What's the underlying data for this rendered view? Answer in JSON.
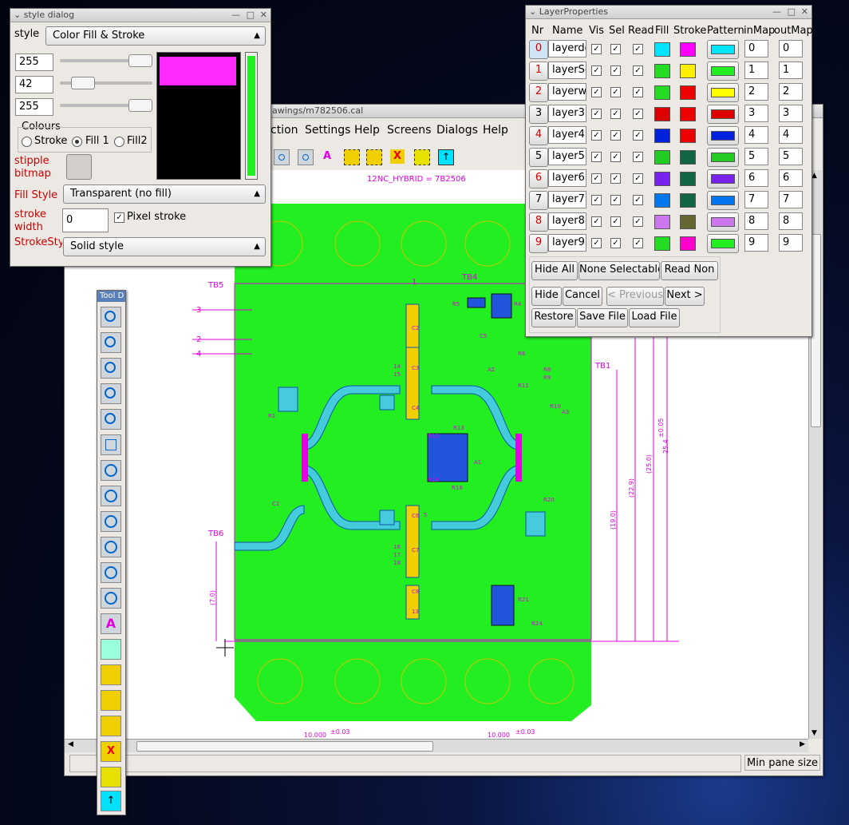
{
  "main_window": {
    "title": "awings/m782506.cal",
    "menu": [
      "ction",
      "Settings",
      "Help",
      "Screens",
      "Dialogs",
      "Help"
    ],
    "status": "Min pane size ="
  },
  "canvas": {
    "top_label": "12NC_HYBRID = 7B2506",
    "labels": [
      "TB5",
      "TB4",
      "TB1",
      "TB6",
      "3",
      "2",
      "4",
      "1"
    ],
    "dims": [
      "(7.0)",
      "(19.0)",
      "(22.9)",
      "(25.0)",
      "25.4",
      "±0.05",
      "10.000",
      "±0.03",
      "10.000",
      "±0.03"
    ],
    "parts": [
      "R1",
      "R5",
      "R4",
      "R6",
      "R8",
      "R9",
      "R10",
      "R11",
      "R12",
      "R13",
      "R18",
      "R19",
      "R20",
      "R21",
      "R24",
      "A1",
      "A2",
      "A3",
      "C1",
      "C2",
      "C3",
      "C4",
      "C5",
      "C6",
      "C7",
      "C8",
      "13",
      "14",
      "15",
      "16",
      "17",
      "18",
      "5"
    ]
  },
  "style_dialog": {
    "title": "style dialog",
    "style_label": "style",
    "style_value": "Color Fill & Stroke",
    "rgb": [
      "255",
      "42",
      "255"
    ],
    "colours_label": "Colours",
    "radios": [
      "Stroke",
      "Fill 1",
      "Fill2"
    ],
    "selected_radio": "Fill 1",
    "stipple_label": "stipple bitmap",
    "fill_style_label": "Fill Style",
    "fill_style_value": "Transparent (no fill)",
    "stroke_width_label": "stroke width",
    "stroke_width_value": "0",
    "pixel_stroke_label": "Pixel stroke",
    "stroke_style_label": "StrokeStyl",
    "stroke_style_value": "Solid style",
    "preview_color": "#ff2aff"
  },
  "tool_dock": {
    "title": "Tool D",
    "tools": [
      "zoom-icon",
      "zoom-region-icon",
      "zoom-fit-icon",
      "zoom-prev-icon",
      "zoom-in-icon",
      "zoom-out-icon",
      "snap-1-icon",
      "snap-2-icon",
      "snap-3-icon",
      "snap-4-icon",
      "snap-5-icon",
      "snap-6-icon",
      "text-icon",
      "image-icon",
      "rotate-icon",
      "select-icon",
      "select-add-icon",
      "delete-icon",
      "move-icon",
      "export-icon"
    ]
  },
  "layer_props": {
    "title": "LayerProperties",
    "headers": [
      "Nr",
      "Name",
      "Vis",
      "Sel",
      "Read",
      "Fill",
      "Stroke",
      "Pattern",
      "inMap",
      "outMap"
    ],
    "rows": [
      {
        "nr": "0",
        "name": "layerdef",
        "fill": "#00e5ff",
        "stroke": "#ff00ff",
        "pattern": "#00e5ff",
        "inmap": "0",
        "outmap": "0",
        "red": true
      },
      {
        "nr": "1",
        "name": "layerSe",
        "fill": "#22dd22",
        "stroke": "#ffee00",
        "pattern": "#22ee22",
        "inmap": "1",
        "outmap": "1",
        "red": true
      },
      {
        "nr": "2",
        "name": "layerwi",
        "fill": "#22dd22",
        "stroke": "#ee0000",
        "pattern": "#ffff00",
        "inmap": "2",
        "outmap": "2",
        "red": true
      },
      {
        "nr": "3",
        "name": "layer3",
        "fill": "#dd0000",
        "stroke": "#ee0000",
        "pattern": "#dd0000",
        "inmap": "3",
        "outmap": "3",
        "red": false
      },
      {
        "nr": "4",
        "name": "layer4",
        "fill": "#0022dd",
        "stroke": "#ee0000",
        "pattern": "#0022dd",
        "inmap": "4",
        "outmap": "4",
        "red": true
      },
      {
        "nr": "5",
        "name": "layer5",
        "fill": "#22cc22",
        "stroke": "#116644",
        "pattern": "#22cc22",
        "inmap": "5",
        "outmap": "5",
        "red": false
      },
      {
        "nr": "6",
        "name": "layer6",
        "fill": "#7722ee",
        "stroke": "#116644",
        "pattern": "#7722ee",
        "inmap": "6",
        "outmap": "6",
        "red": true
      },
      {
        "nr": "7",
        "name": "layer7",
        "fill": "#0077ee",
        "stroke": "#116644",
        "pattern": "#0077ee",
        "inmap": "7",
        "outmap": "7",
        "red": false
      },
      {
        "nr": "8",
        "name": "layer8",
        "fill": "#cc77ee",
        "stroke": "#666633",
        "pattern": "#cc77ee",
        "inmap": "8",
        "outmap": "8",
        "red": true
      },
      {
        "nr": "9",
        "name": "layer9",
        "fill": "#22dd22",
        "stroke": "#ff00cc",
        "pattern": "#22ee22",
        "inmap": "9",
        "outmap": "9",
        "red": true
      }
    ],
    "buttons": {
      "hide_all": "Hide All",
      "none_selectable": "None Selectable",
      "read_non": "Read Non",
      "hide": "Hide",
      "cancel": "Cancel",
      "previous": "< Previous",
      "next": "Next >",
      "restore": "Restore",
      "save_file": "Save File",
      "load_file": "Load File"
    }
  }
}
